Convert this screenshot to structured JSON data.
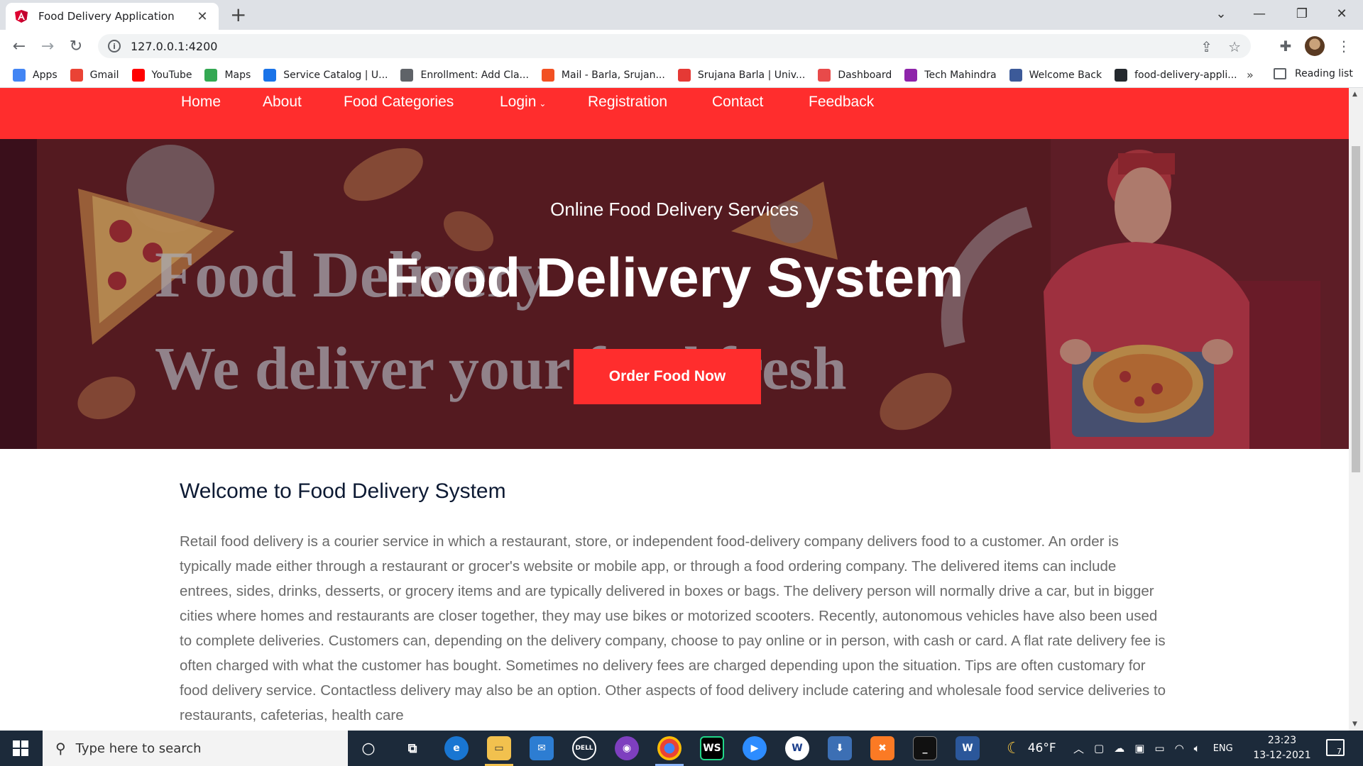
{
  "browser": {
    "tab_title": "Food Delivery Application",
    "url": "127.0.0.1:4200",
    "bookmarks": [
      {
        "label": "Apps",
        "color": "#4285f4"
      },
      {
        "label": "Gmail",
        "color": "#ea4335"
      },
      {
        "label": "YouTube",
        "color": "#ff0000"
      },
      {
        "label": "Maps",
        "color": "#34a853"
      },
      {
        "label": "Service Catalog | U...",
        "color": "#1a73e8"
      },
      {
        "label": "Enrollment: Add Cla...",
        "color": "#5f6368"
      },
      {
        "label": "Mail - Barla, Srujan...",
        "color": "#f25022"
      },
      {
        "label": "Srujana Barla | Univ...",
        "color": "#e53935"
      },
      {
        "label": "Dashboard",
        "color": "#e84a4a"
      },
      {
        "label": "Tech Mahindra",
        "color": "#8e24aa"
      },
      {
        "label": "Welcome Back",
        "color": "#3c5a99"
      },
      {
        "label": "food-delivery-appli...",
        "color": "#24292e"
      }
    ],
    "more": "»",
    "reading_list": "Reading list"
  },
  "site": {
    "nav": {
      "home": "Home",
      "about": "About",
      "categories": "Food Categories",
      "login": "Login",
      "registration": "Registration",
      "contact": "Contact",
      "feedback": "Feedback"
    },
    "hero": {
      "subtitle": "Online Food Delivery Services",
      "headline": "Food Delivery System",
      "cta": "Order Food Now",
      "background_text_1": "Food Delivery",
      "background_text_2": "We deliver your food fresh"
    },
    "welcome_title": "Welcome to Food Delivery System",
    "intro": "Retail food delivery is a courier service in which a restaurant, store, or independent food-delivery company delivers food to a customer. An order is typically made either through a restaurant or grocer's website or mobile app, or through a food ordering company. The delivered items can include entrees, sides, drinks, desserts, or grocery items and are typically delivered in boxes or bags. The delivery person will normally drive a car, but in bigger cities where homes and restaurants are closer together, they may use bikes or motorized scooters. Recently, autonomous vehicles have also been used to complete deliveries. Customers can, depending on the delivery company, choose to pay online or in person, with cash or card. A flat rate delivery fee is often charged with what the customer has bought. Sometimes no delivery fees are charged depending upon the situation. Tips are often customary for food delivery service. Contactless delivery may also be an option. Other aspects of food delivery include catering and wholesale food service deliveries to restaurants, cafeterias, health care"
  },
  "taskbar": {
    "search_placeholder": "Type here to search",
    "weather": "46°F",
    "language": "ENG",
    "time": "23:23",
    "date": "13-12-2021",
    "notifications": "7"
  },
  "colors": {
    "brand_red": "#ff2d2d",
    "heading": "#0d1a33",
    "body_text": "#6a6a6a"
  }
}
